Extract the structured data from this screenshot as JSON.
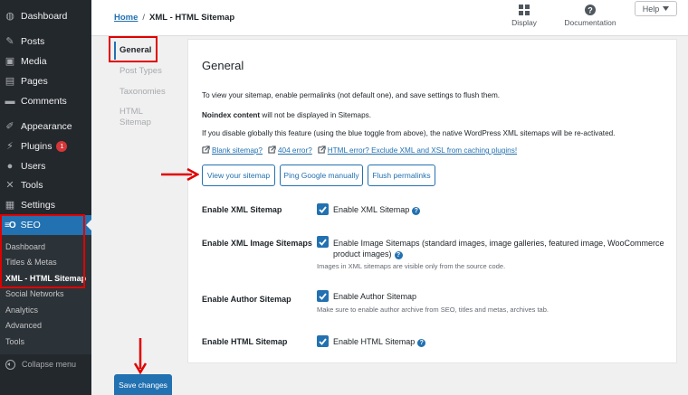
{
  "sidebar": {
    "items": [
      {
        "label": "Dashboard",
        "icon": "dashboard-icon",
        "glyph": "◍"
      },
      {
        "label": "Posts",
        "icon": "pin-icon",
        "glyph": "✎"
      },
      {
        "label": "Media",
        "icon": "media-icon",
        "glyph": "▣"
      },
      {
        "label": "Pages",
        "icon": "pages-icon",
        "glyph": "▤"
      },
      {
        "label": "Comments",
        "icon": "comment-icon",
        "glyph": "▬"
      },
      {
        "label": "Appearance",
        "icon": "brush-icon",
        "glyph": "✐"
      },
      {
        "label": "Plugins",
        "icon": "plug-icon",
        "glyph": "⚡",
        "badge": "1"
      },
      {
        "label": "Users",
        "icon": "user-icon",
        "glyph": "●"
      },
      {
        "label": "Tools",
        "icon": "wrench-icon",
        "glyph": "✕"
      },
      {
        "label": "Settings",
        "icon": "sliders-icon",
        "glyph": "▦"
      }
    ],
    "seo": {
      "label": "SEO",
      "logo": "≡O"
    },
    "seo_sub": [
      "Dashboard",
      "Titles & Metas",
      "XML - HTML Sitemap",
      "Social Networks",
      "Analytics",
      "Advanced",
      "Tools"
    ],
    "collapse_label": "Collapse menu"
  },
  "header": {
    "breadcrumb_home": "Home",
    "breadcrumb_sep": "/",
    "breadcrumb_current": "XML - HTML Sitemap",
    "display_label": "Display",
    "documentation_label": "Documentation",
    "help_label": "Help"
  },
  "tabs": [
    "General",
    "Post Types",
    "Taxonomies",
    "HTML Sitemap"
  ],
  "panel": {
    "title": "General",
    "intro": "To view your sitemap, enable permalinks (not default one), and save settings to flush them.",
    "noindex_bold": "Noindex content",
    "noindex_rest": " will not be displayed in Sitemaps.",
    "disable_note": "If you disable globally this feature (using the blue toggle from above), the native WordPress XML sitemaps will be re-activated.",
    "links": [
      "Blank sitemap?",
      "404 error?",
      "HTML error? Exclude XML and XSL from caching plugins!"
    ],
    "buttons": [
      "View your sitemap",
      "Ping Google manually",
      "Flush permalinks"
    ],
    "options": [
      {
        "label": "Enable XML Sitemap",
        "checkbox": "Enable XML Sitemap",
        "note": ""
      },
      {
        "label": "Enable XML Image Sitemaps",
        "checkbox": "Enable Image Sitemaps (standard images, image galleries, featured image, WooCommerce",
        "checkbox_line2": "product images)",
        "note": "Images in XML sitemaps are visible only from the source code."
      },
      {
        "label": "Enable Author Sitemap",
        "checkbox": "Enable Author Sitemap",
        "note": "Make sure to enable author archive from SEO, titles and metas, archives tab."
      },
      {
        "label": "Enable HTML Sitemap",
        "checkbox": "Enable HTML Sitemap",
        "note": ""
      }
    ],
    "save_label": "Save changes"
  },
  "colors": {
    "accent": "#2271b1",
    "sidebar": "#23282d",
    "annotation": "#e00000"
  }
}
